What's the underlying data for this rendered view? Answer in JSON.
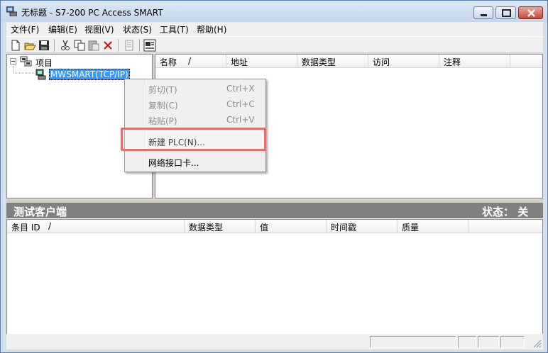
{
  "window": {
    "title": "无标题 - S7-200 PC Access SMART"
  },
  "menubar": {
    "items": [
      {
        "label": "文件(F)"
      },
      {
        "label": "编辑(E)"
      },
      {
        "label": "视图(V)"
      },
      {
        "label": "状态(S)"
      },
      {
        "label": "工具(T)"
      },
      {
        "label": "帮助(H)"
      }
    ]
  },
  "toolbar": {
    "icons": [
      "new-icon",
      "open-icon",
      "save-icon",
      "cut-icon",
      "copy-icon",
      "paste-icon",
      "delete-icon",
      "properties-icon",
      "test-client-icon"
    ]
  },
  "tree": {
    "root_label": "项目",
    "child_label": "MWSMART(TCP/IP)"
  },
  "item_list": {
    "columns": [
      "名称",
      "地址",
      "数据类型",
      "访问",
      "注释"
    ],
    "sort_indicator": "/"
  },
  "test_client": {
    "title": "测试客户端",
    "status_text": "状态： 关",
    "columns": [
      "条目 ID",
      "数据类型",
      "值",
      "时间戳",
      "质量"
    ],
    "sort_indicator": "/"
  },
  "context_menu": {
    "items": [
      {
        "label": "剪切(T)",
        "shortcut": "Ctrl+X",
        "enabled": false
      },
      {
        "label": "复制(C)",
        "shortcut": "Ctrl+C",
        "enabled": false
      },
      {
        "label": "粘贴(P)",
        "shortcut": "Ctrl+V",
        "enabled": false
      },
      {
        "label": "新建 PLC(N)...",
        "shortcut": "",
        "enabled": true
      },
      {
        "label": "网络接口卡...",
        "shortcut": "",
        "enabled": true
      }
    ],
    "highlight_color": "#e07070"
  },
  "colors": {
    "selection": "#3399ff",
    "client_bar": "#808080"
  }
}
